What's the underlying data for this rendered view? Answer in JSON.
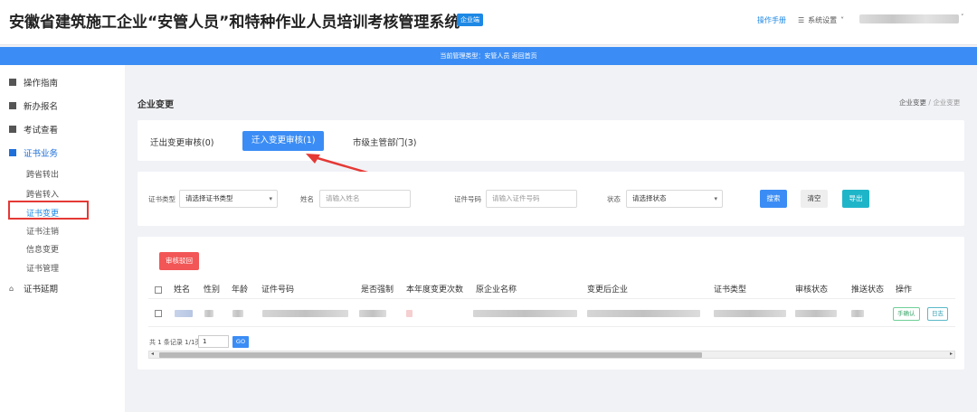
{
  "header": {
    "title": "安徽省建筑施工企业“安管人员”和特种作业人员培训考核管理系统",
    "edition_badge": "企业端",
    "manual_link": "操作手册",
    "settings_label": "系统设置",
    "settings_icon": "menu-icon",
    "user_caret": "˅"
  },
  "notice": "当前管理类型：安管人员 返回首页",
  "sidebar": {
    "items": [
      {
        "label": "操作指南",
        "icon": "table-icon"
      },
      {
        "label": "新办报名",
        "icon": "doc-icon"
      },
      {
        "label": "考试查看",
        "icon": "table-icon"
      },
      {
        "label": "证书业务",
        "icon": "doc-icon"
      },
      {
        "label": "证书延期",
        "icon": "home-icon"
      }
    ],
    "subitems": [
      "跨省转出",
      "跨省转入",
      "证书变更",
      "证书注销",
      "信息变更",
      "证书管理"
    ],
    "home_glyph": "⌂"
  },
  "page": {
    "title": "企业变更",
    "breadcrumb": {
      "first": "企业变更",
      "sep": "/",
      "current": "企业变更"
    }
  },
  "tabs": [
    "迁出变更审核(0)",
    "迁入变更审核(1)",
    "市级主管部门(3)"
  ],
  "filters": {
    "cert_type_label": "证书类型",
    "cert_type_value": "请选择证书类型",
    "name_label": "姓名",
    "name_placeholder": "请输入姓名",
    "cert_no_label": "证件号码",
    "cert_no_placeholder": "请输入证件号码",
    "status_label": "状态",
    "status_value": "请选择状态",
    "search": "搜索",
    "clear": "清空",
    "export": "导出",
    "caret": "▾"
  },
  "table": {
    "reject_button": "审核驳回",
    "columns": [
      "姓名",
      "性别",
      "年龄",
      "证件号码",
      "是否强制",
      "本年度变更次数",
      "原企业名称",
      "变更后企业",
      "证书类型",
      "审核状态",
      "推送状态",
      "操作"
    ],
    "row_actions": [
      "手确认",
      "日志"
    ]
  },
  "pager": {
    "summary": "共 1 条记录 1/1页",
    "page_value": "1",
    "go": "GO"
  },
  "scroll": {
    "left": "◂",
    "right": "▸"
  },
  "colors": {
    "primary": "#3b8df5",
    "danger": "#f25656",
    "export": "#1fb5c9",
    "highlight": "#e53935"
  }
}
